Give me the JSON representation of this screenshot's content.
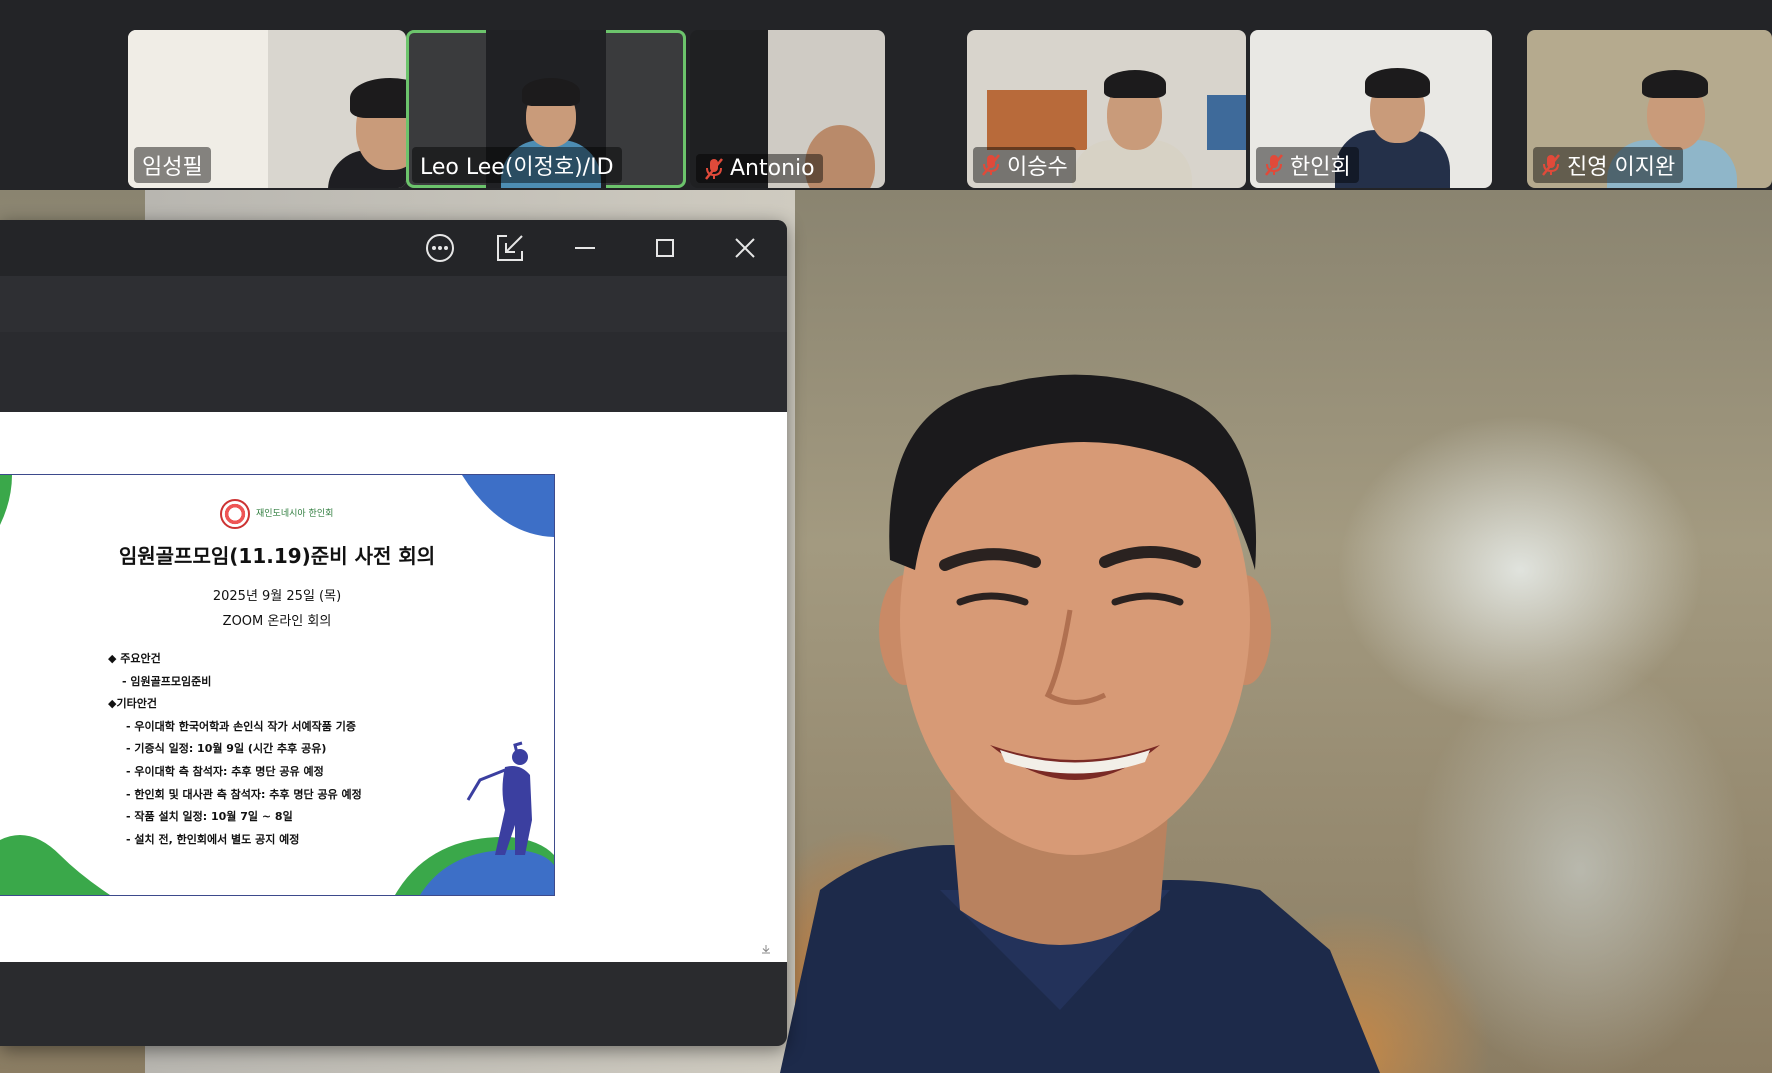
{
  "participants": [
    {
      "name": "임성필",
      "muted": false,
      "active": false
    },
    {
      "name": "Leo Lee(이정호)/ID",
      "muted": false,
      "active": true
    },
    {
      "name": "Antonio",
      "muted": true,
      "active": false
    },
    {
      "name": "이승수",
      "muted": true,
      "active": false
    },
    {
      "name": "한인회",
      "muted": true,
      "active": false
    },
    {
      "name": "진영 이지완",
      "muted": true,
      "active": false
    }
  ],
  "share_window": {
    "controls": [
      "more-options-icon",
      "pop-in-icon",
      "minimize-icon",
      "maximize-icon",
      "close-icon"
    ]
  },
  "slide": {
    "logo_line1": "재인도네시아 한인회",
    "logo_line2": "",
    "title": "임원골프모임(11.19)준비 사전 회의",
    "date": "2025년 9월 25일 (목)",
    "venue": "ZOOM 온라인 회의",
    "agenda": {
      "main_heading": "◆ 주요안건",
      "main_item": "- 임원골프모임준비",
      "other_heading": "◆기타안건",
      "other_items": [
        "- 우이대학 한국어학과 손인식 작가 서예작품 기증",
        "- 기증식 일정: 10월 9일 (시간 추후 공유)",
        "- 우이대학 측 참석자: 추후 명단 공유 예정",
        "- 한인회 및 대사관 측 참석자: 추후 명단 공유 예정",
        "- 작품 설치 일정: 10월 7일 ~ 8일",
        "- 설치 전, 한인회에서 별도 공지 예정"
      ]
    }
  },
  "colors": {
    "active_border": "#6cc46c",
    "slide_blue": "#3d6fc7",
    "slide_green": "#3aa84a",
    "golfer": "#3b3fa0",
    "muted_mic": "#e04a3a"
  }
}
